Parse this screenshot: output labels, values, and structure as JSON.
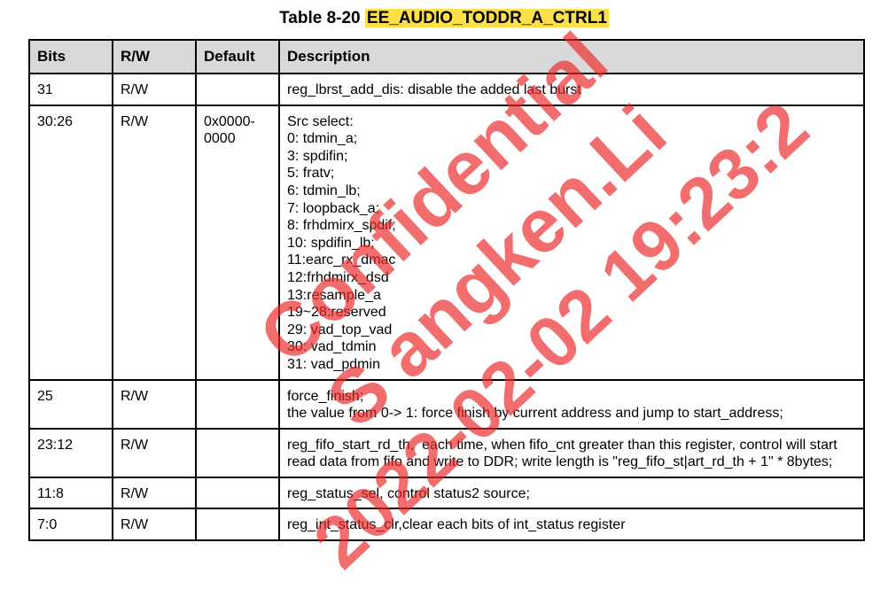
{
  "title": {
    "prefix": "Table 8-20 ",
    "register": "EE_AUDIO_TODDR_A_CTRL1"
  },
  "table": {
    "headers": [
      "Bits",
      "R/W",
      "Default",
      "Description"
    ],
    "rows": [
      {
        "bits": "31",
        "rw": "R/W",
        "default": "",
        "description": [
          "reg_lbrst_add_dis: disable the added last burst"
        ]
      },
      {
        "bits": "30:26",
        "rw": "R/W",
        "default": "0x0000-\n0000",
        "description": [
          "Src select:",
          "0: tdmin_a;",
          "3: spdifin;",
          "5: fratv;",
          "6: tdmin_lb;",
          "7: loopback_a;",
          "8: frhdmirx_spdif;",
          "10: spdifin_lb;",
          "11:earc_rx_dmac",
          "12:frhdmirx_dsd",
          "13:resample_a",
          "19~28:reserved",
          "29: vad_top_vad",
          "30: vad_tdmin",
          "31: vad_pdmin"
        ]
      },
      {
        "bits": "25",
        "rw": "R/W",
        "default": "",
        "description": [
          "force_finish;",
          "the value from 0-> 1: force finish by current address and jump to start_address;"
        ]
      },
      {
        "bits": "23:12",
        "rw": "R/W",
        "default": "",
        "description": [
          "reg_fifo_start_rd_th,  each time, when fifo_cnt greater than this register, control will start read data from fifo and write to DDR; write length is \"reg_fifo_st|art_rd_th + 1\" * 8bytes;"
        ]
      },
      {
        "bits": "11:8",
        "rw": "R/W",
        "default": "",
        "description": [
          "reg_status_sel, control status2 source;"
        ]
      },
      {
        "bits": "7:0",
        "rw": "R/W",
        "default": "",
        "description": [
          "reg_int_status_clr,clear each bits of int_status register"
        ]
      }
    ]
  },
  "watermark": {
    "color": "#ec2828",
    "lines": [
      "Confidential",
      "S  angken.Li",
      "2022-02-02 19:23:2"
    ]
  }
}
